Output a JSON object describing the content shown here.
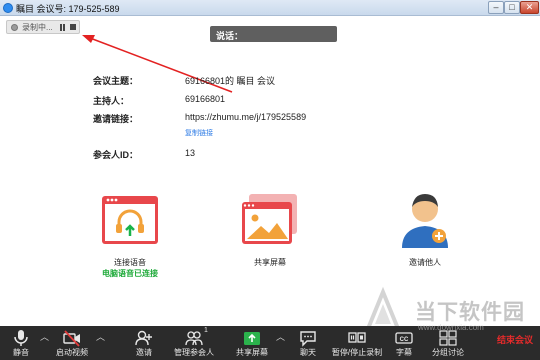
{
  "window": {
    "title": "瞩目 会议号: 179-525-589",
    "min_label": "–",
    "max_label": "□",
    "close_label": "✕"
  },
  "recording": {
    "label": "录制中..."
  },
  "speaking": {
    "label": "说话："
  },
  "meeting_info": {
    "topic_label": "会议主题：",
    "topic_value": "69166801的 瞩目 会议",
    "host_label": "主持人：",
    "host_value": "69166801",
    "invite_label": "邀请链接：",
    "invite_value": "https://zhumu.me/j/179525589",
    "copy_link": "复制链接",
    "participant_label": "参会人ID：",
    "participant_value": "13"
  },
  "actions": {
    "audio_label": "连接语音",
    "audio_status": "电脑语音已连接",
    "share_label": "共享屏幕",
    "invite_label": "邀请他人"
  },
  "toolbar": {
    "mute": "静音",
    "video": "启动视频",
    "invite": "邀请",
    "participants": "管理参会人",
    "participants_count": "1",
    "share": "共享屏幕",
    "chat": "聊天",
    "record": "暂停/停止录制",
    "captions": "字幕",
    "breakout": "分组讨论",
    "end": "结束会议"
  },
  "watermark": {
    "text": "当下软件园",
    "url": "www.downxia.com"
  },
  "colors": {
    "accent_red": "#e8474b",
    "link_blue": "#2d7be5",
    "status_green": "#1faa3a",
    "toolbar_bg": "#2b2b2b"
  }
}
